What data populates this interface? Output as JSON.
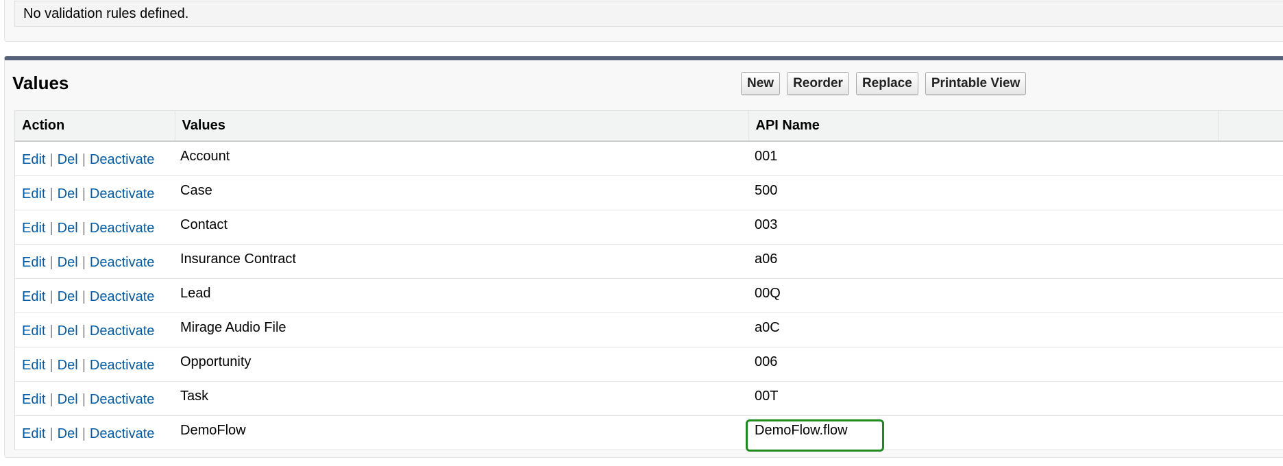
{
  "validation": {
    "message": "No validation rules defined."
  },
  "values_section": {
    "title": "Values",
    "buttons": {
      "new": "New",
      "reorder": "Reorder",
      "replace": "Replace",
      "printable_view": "Printable View"
    },
    "columns": {
      "action": "Action",
      "values": "Values",
      "api_name": "API Name",
      "extra": ""
    },
    "action_links": {
      "edit": "Edit",
      "del": "Del",
      "deactivate": "Deactivate",
      "separator": "|"
    },
    "rows": [
      {
        "value": "Account",
        "api_name": "001"
      },
      {
        "value": "Case",
        "api_name": "500"
      },
      {
        "value": "Contact",
        "api_name": "003"
      },
      {
        "value": "Insurance Contract",
        "api_name": "a06"
      },
      {
        "value": "Lead",
        "api_name": "00Q"
      },
      {
        "value": "Mirage Audio File",
        "api_name": "a0C"
      },
      {
        "value": "Opportunity",
        "api_name": "006"
      },
      {
        "value": "Task",
        "api_name": "00T"
      },
      {
        "value": "DemoFlow",
        "api_name": "DemoFlow.flow"
      }
    ]
  },
  "colors": {
    "link": "#015ba7",
    "header_border": "#56627a",
    "highlight": "#1c8a1c"
  }
}
